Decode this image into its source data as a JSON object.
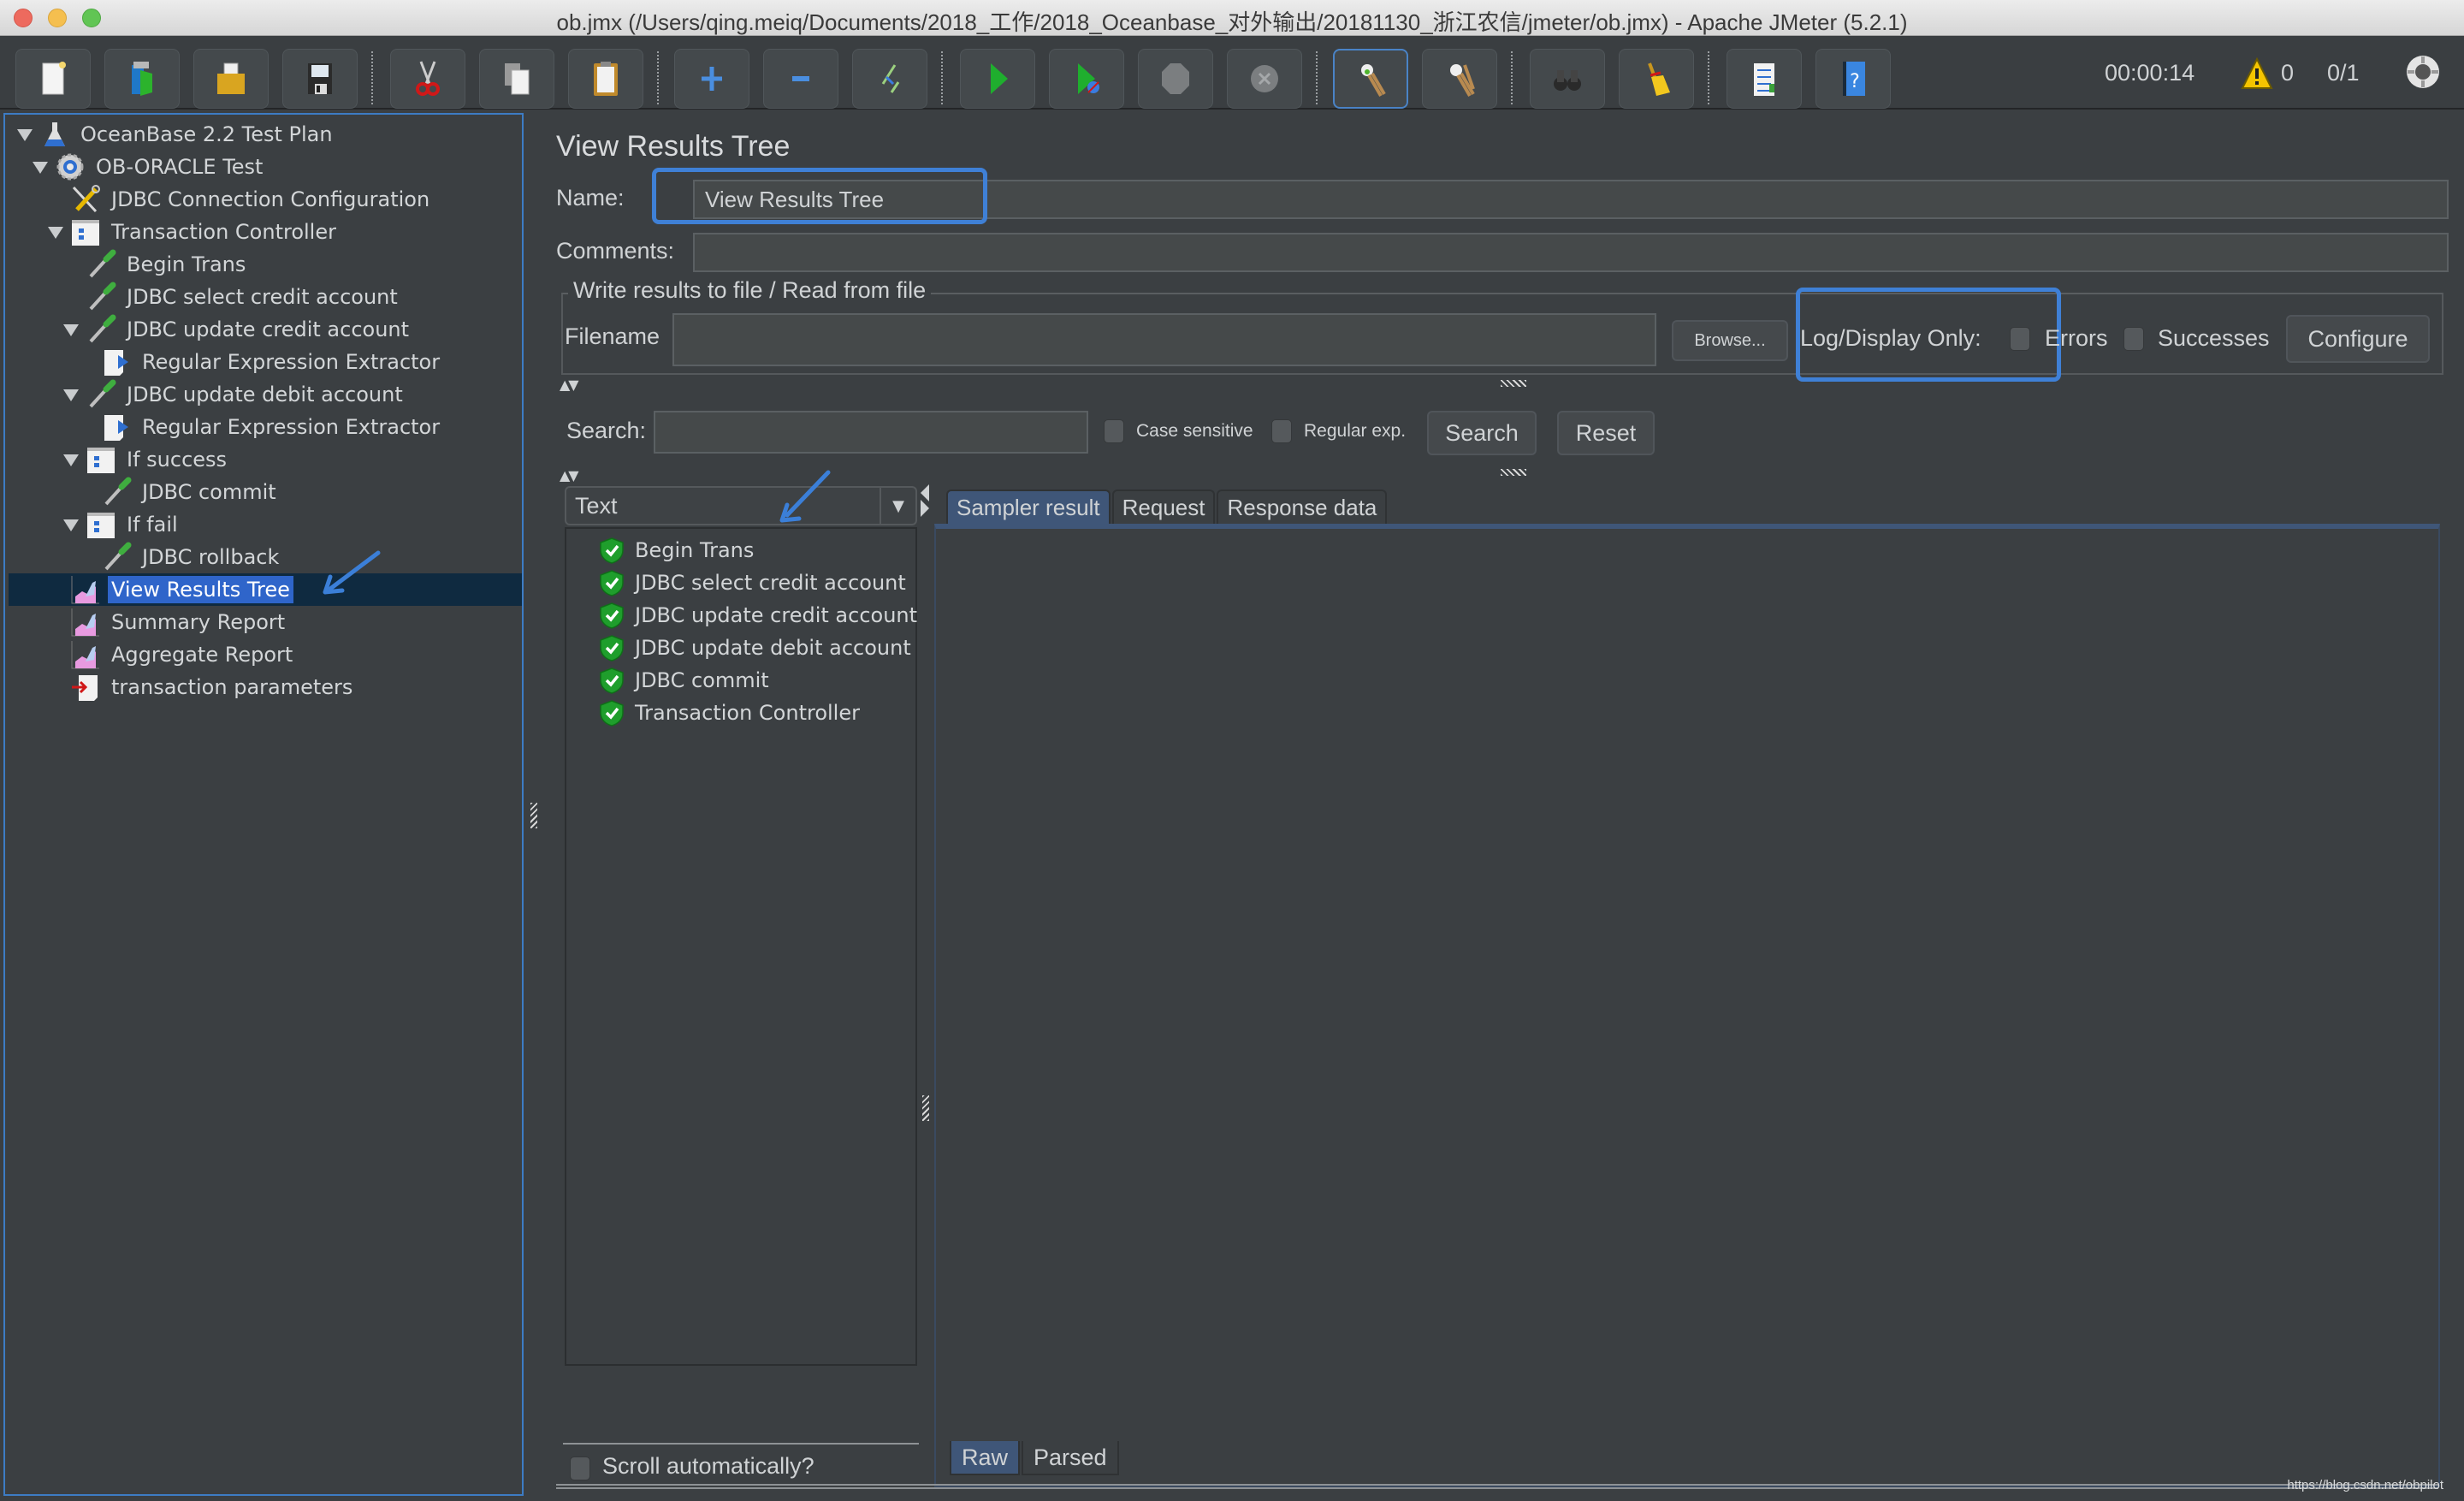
{
  "window": {
    "title": "ob.jmx (/Users/qing.meiq/Documents/2018_工作/2018_Oceanbase_对外输出/20181130_浙江农信/jmeter/ob.jmx) - Apache JMeter (5.2.1)"
  },
  "toolbar": {
    "buttons": [
      {
        "name": "new",
        "icon": "new-document-icon"
      },
      {
        "name": "templates",
        "icon": "templates-icon"
      },
      {
        "name": "open",
        "icon": "open-folder-icon"
      },
      {
        "name": "save",
        "icon": "save-floppy-icon"
      },
      {
        "name": "cut",
        "icon": "scissors-icon"
      },
      {
        "name": "copy",
        "icon": "copy-icon"
      },
      {
        "name": "paste",
        "icon": "paste-clipboard-icon"
      },
      {
        "name": "expand-all",
        "icon": "plus-icon"
      },
      {
        "name": "collapse-all",
        "icon": "minus-icon"
      },
      {
        "name": "toggle",
        "icon": "toggle-wand-icon"
      },
      {
        "name": "start",
        "icon": "play-icon"
      },
      {
        "name": "start-no-pauses",
        "icon": "play-no-timers-icon"
      },
      {
        "name": "stop",
        "icon": "stop-icon"
      },
      {
        "name": "shutdown",
        "icon": "shutdown-icon"
      },
      {
        "name": "clear",
        "icon": "clear-broom-icon"
      },
      {
        "name": "clear-all",
        "icon": "clear-all-broom-icon"
      },
      {
        "name": "search",
        "icon": "binoculars-icon"
      },
      {
        "name": "reset-search",
        "icon": "reset-search-broom-icon"
      },
      {
        "name": "function-helper",
        "icon": "function-list-icon"
      },
      {
        "name": "help",
        "icon": "help-book-icon"
      }
    ],
    "elapsed_time": "00:00:14",
    "warning_count": "0",
    "active_threads": "0/1"
  },
  "tree": {
    "items": [
      {
        "label": "OceanBase 2.2 Test Plan",
        "icon": "test-plan-flask-icon",
        "level": 0,
        "expanded": true
      },
      {
        "label": "OB-ORACLE Test",
        "icon": "thread-group-gear-icon",
        "level": 1,
        "expanded": true
      },
      {
        "label": "JDBC Connection Configuration",
        "icon": "config-tools-icon",
        "level": 2
      },
      {
        "label": "Transaction Controller",
        "icon": "controller-icon",
        "level": 2,
        "expanded": true
      },
      {
        "label": "Begin Trans",
        "icon": "sampler-pipette-icon",
        "level": 3
      },
      {
        "label": "JDBC select credit account",
        "icon": "sampler-pipette-icon",
        "level": 3
      },
      {
        "label": "JDBC update credit account",
        "icon": "sampler-pipette-icon",
        "level": 3,
        "expanded": true
      },
      {
        "label": "Regular Expression Extractor",
        "icon": "post-processor-icon",
        "level": 4
      },
      {
        "label": "JDBC update debit account",
        "icon": "sampler-pipette-icon",
        "level": 3,
        "expanded": true
      },
      {
        "label": "Regular Expression Extractor",
        "icon": "post-processor-icon",
        "level": 4
      },
      {
        "label": "If success",
        "icon": "controller-icon",
        "level": 3,
        "expanded": true
      },
      {
        "label": "JDBC commit",
        "icon": "sampler-pipette-icon",
        "level": 4
      },
      {
        "label": "If fail",
        "icon": "controller-icon",
        "level": 3,
        "expanded": true
      },
      {
        "label": "JDBC rollback",
        "icon": "sampler-pipette-icon",
        "level": 4
      },
      {
        "label": "View Results Tree",
        "icon": "listener-graph-icon",
        "level": 2,
        "selected": true
      },
      {
        "label": "Summary Report",
        "icon": "listener-graph-icon",
        "level": 2
      },
      {
        "label": "Aggregate Report",
        "icon": "listener-graph-icon",
        "level": 2
      },
      {
        "label": "transaction parameters",
        "icon": "pre-processor-icon",
        "level": 2
      }
    ]
  },
  "panel": {
    "title": "View Results Tree",
    "name_label": "Name:",
    "name_value": "View Results Tree",
    "comments_label": "Comments:",
    "comments_value": "",
    "file_group_title": "Write results to file / Read from file",
    "filename_label": "Filename",
    "filename_value": "",
    "browse_label": "Browse...",
    "log_display_label": "Log/Display Only:",
    "errors_label": "Errors",
    "errors_checked": false,
    "successes_label": "Successes",
    "successes_checked": false,
    "configure_label": "Configure"
  },
  "search": {
    "label": "Search:",
    "value": "",
    "case_sensitive_label": "Case sensitive",
    "regex_label": "Regular exp.",
    "search_button": "Search",
    "reset_button": "Reset"
  },
  "results": {
    "renderer": "Text",
    "items": [
      {
        "label": "Begin Trans",
        "status": "success"
      },
      {
        "label": "JDBC select credit account",
        "status": "success"
      },
      {
        "label": "JDBC update credit account",
        "status": "success"
      },
      {
        "label": "JDBC update debit account",
        "status": "success"
      },
      {
        "label": "JDBC commit",
        "status": "success"
      },
      {
        "label": "Transaction Controller",
        "status": "success"
      }
    ],
    "scroll_auto_label": "Scroll automatically?",
    "scroll_auto_checked": false,
    "tabs": [
      "Sampler result",
      "Request",
      "Response data"
    ],
    "selected_tab": "Sampler result",
    "view_tabs": [
      "Raw",
      "Parsed"
    ],
    "selected_view_tab": "Raw"
  },
  "colors": {
    "accent_blue": "#3f80d6",
    "selection": "#2f65ca",
    "success_green": "#22a034",
    "background": "#3b3f42"
  },
  "watermark": "https://blog.csdn.net/obpilot"
}
